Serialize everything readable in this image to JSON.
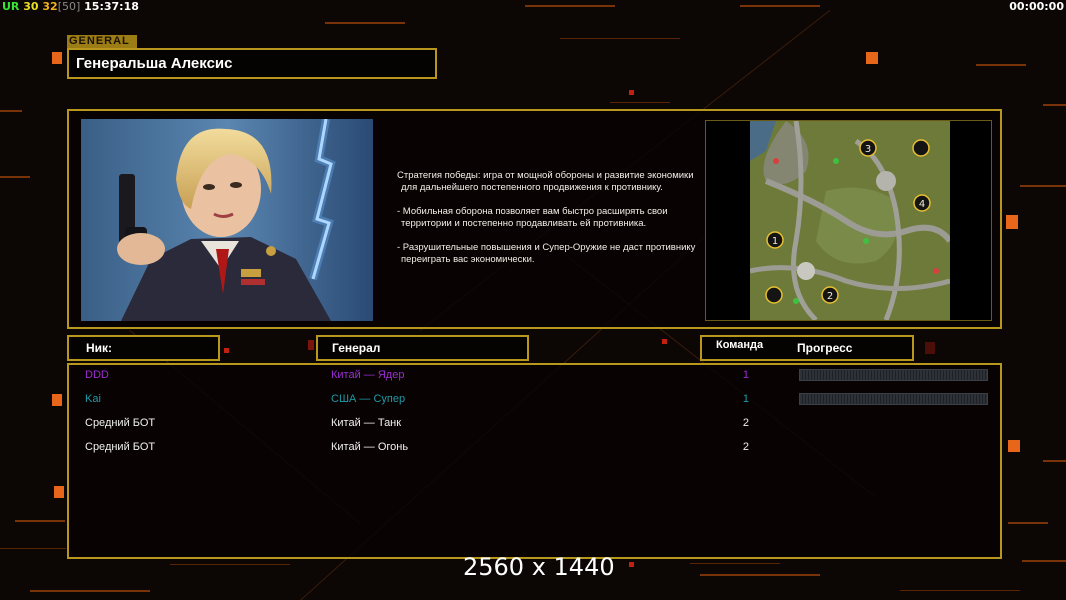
{
  "topbar": {
    "ur": "UR",
    "val1": "30",
    "val2": "32",
    "val3": "[50]",
    "clock": "15:37:18",
    "timer": "00:00:00"
  },
  "general": {
    "tag": "GENERAL",
    "name": "Генеральша Алексис",
    "description": [
      "Стратегия победы: игра от мощной обороны и развитие экономики для дальнейшего постепенного продвижения к противнику.",
      "- Мобильная оборона позволяет вам быстро расширять свои территории и постепенно продавливать ей противника.",
      "- Разрушительные повышения и Супер-Оружие не даст противнику переиграть вас экономически."
    ]
  },
  "map": {
    "slots": [
      "1",
      "2",
      "3",
      "4"
    ]
  },
  "roster": {
    "headers": {
      "nick": "Ник:",
      "general": "Генерал",
      "team": "Команда",
      "progress": "Прогресс"
    },
    "players": [
      {
        "nick": "DDD",
        "general": "Китай — Ядер",
        "team": "1",
        "color": "#9a2ed0",
        "progress": 0.0
      },
      {
        "nick": "Kai",
        "general": "США — Супер",
        "team": "1",
        "color": "#1e9aa8",
        "progress": 0.0
      },
      {
        "nick": "Средний БОТ",
        "general": "Китай — Танк",
        "team": "2",
        "color": "#f0f0f0"
      },
      {
        "nick": "Средний БОТ",
        "general": "Китай — Огонь",
        "team": "2",
        "color": "#f0f0f0"
      }
    ]
  },
  "watermark": "2560 x 1440",
  "colors": {
    "frame": "#b8981c",
    "background": "#0c0604",
    "accent": "#e8661a"
  }
}
